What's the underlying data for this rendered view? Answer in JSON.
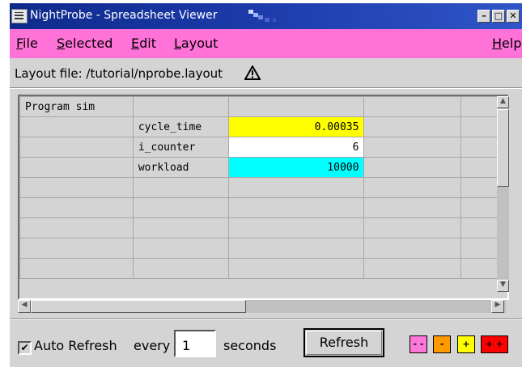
{
  "window": {
    "title": "NightProbe - Spreadsheet Viewer",
    "minimize_glyph": "–",
    "maximize_glyph": "□",
    "close_glyph": "✕",
    "title_bar_color": "#1b3aa8"
  },
  "menubar": {
    "color": "#ff72d8",
    "items": [
      {
        "label": "File",
        "hotkey": "F",
        "rest": "ile"
      },
      {
        "label": "Selected",
        "hotkey": "S",
        "rest": "elected"
      },
      {
        "label": "Edit",
        "hotkey": "E",
        "rest": "dit"
      },
      {
        "label": "Layout",
        "hotkey": "L",
        "rest": "ayout"
      },
      {
        "label": "Help",
        "hotkey": "H",
        "rest": "elp"
      }
    ]
  },
  "layout_file": {
    "label": "Layout file: /tutorial/nprobe.layout",
    "icon": "warning-icon"
  },
  "sheet": {
    "rows": [
      [
        "Program sim",
        "",
        "",
        "",
        ""
      ],
      [
        "",
        "cycle_time",
        "0.00035",
        "",
        ""
      ],
      [
        "",
        "i_counter",
        "6",
        "",
        ""
      ],
      [
        "",
        "workload",
        "10000",
        "",
        ""
      ],
      [
        "",
        "",
        "",
        "",
        ""
      ],
      [
        "",
        "",
        "",
        "",
        ""
      ],
      [
        "",
        "",
        "",
        "",
        ""
      ],
      [
        "",
        "",
        "",
        "",
        ""
      ],
      [
        "",
        "",
        "",
        "",
        ""
      ]
    ],
    "cell_colors": {
      "cycle_time": "#ffff00",
      "i_counter": "#ffffff",
      "workload": "#00ffff"
    }
  },
  "controls": {
    "auto_refresh_label": "Auto Refresh",
    "auto_refresh_checked": true,
    "every_label": "every",
    "seconds_value": "1",
    "seconds_label": "seconds",
    "refresh_button": "Refresh",
    "color_buttons": [
      {
        "label": "- -",
        "color": "#ff77d8"
      },
      {
        "label": "-",
        "color": "#ff9900"
      },
      {
        "label": "+",
        "color": "#ffff00"
      },
      {
        "label": "+ +",
        "color": "#ff0000"
      }
    ]
  }
}
